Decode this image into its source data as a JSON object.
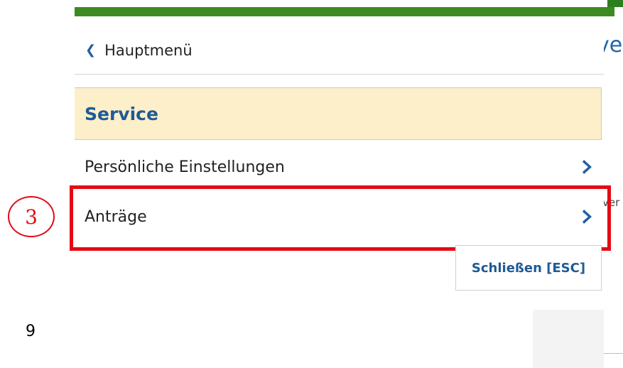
{
  "menu": {
    "back_label": "Hauptmenü",
    "section_title": "Service",
    "items": [
      {
        "label": "Persönliche Einstellungen",
        "icon": "chevron-right-icon"
      },
      {
        "label": "Anträge",
        "icon": "chevron-right-icon"
      }
    ],
    "close_label": "Schließen [ESC]"
  },
  "background": {
    "heading_fragment": "ve",
    "text_fragment": "ver"
  },
  "annotations": {
    "step_number": "3",
    "page_number": "9"
  },
  "colors": {
    "accent_green": "#3c8a21",
    "link_blue": "#1f5a96",
    "section_bg": "#fcefc9",
    "highlight_red": "#e50914"
  }
}
